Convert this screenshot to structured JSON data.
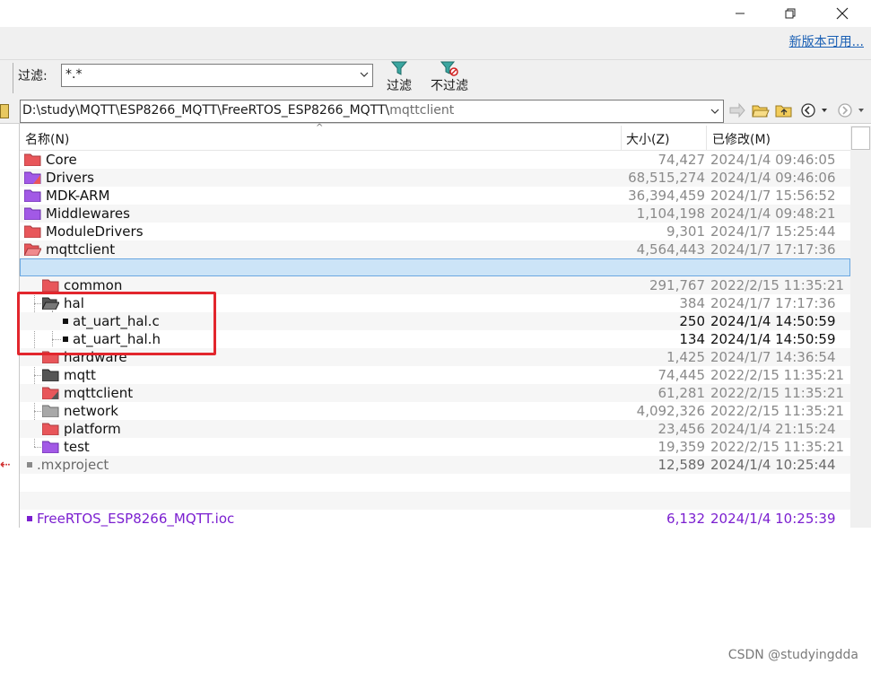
{
  "window": {
    "minimize_icon": "minimize-icon",
    "maximize_icon": "restore-icon",
    "close_icon": "close-icon"
  },
  "toolbar": {
    "new_version_link": "新版本可用...",
    "filter_label": "过滤:",
    "filter_value": "*.*",
    "filter_button_label": "过滤",
    "no_filter_button_label": "不过滤"
  },
  "pathbar": {
    "path_prefix": "D:\\study\\MQTT\\ESP8266_MQTT\\FreeRTOS_ESP8266_MQTT\\",
    "path_current": "mqttclient"
  },
  "columns": {
    "name": "名称(N)",
    "size": "大小(Z)",
    "modified": "已修改(M)"
  },
  "rows": [
    {
      "name": "Core",
      "size": "74,427",
      "date": "2024/1/4 09:46:05"
    },
    {
      "name": "Drivers",
      "size": "68,515,274",
      "date": "2024/1/4 09:46:06"
    },
    {
      "name": "MDK-ARM",
      "size": "36,394,459",
      "date": "2024/1/7 15:56:52"
    },
    {
      "name": "Middlewares",
      "size": "1,104,198",
      "date": "2024/1/4 09:48:21"
    },
    {
      "name": "ModuleDrivers",
      "size": "9,301",
      "date": "2024/1/7 15:25:44"
    },
    {
      "name": "mqttclient",
      "size": "4,564,443",
      "date": "2024/1/7 17:17:36"
    },
    {
      "name": "",
      "size": "",
      "date": ""
    },
    {
      "name": "common",
      "size": "291,767",
      "date": "2022/2/15 11:35:21"
    },
    {
      "name": "hal",
      "size": "384",
      "date": "2024/1/7 17:17:36"
    },
    {
      "name": "at_uart_hal.c",
      "size": "250",
      "date": "2024/1/4 14:50:59"
    },
    {
      "name": "at_uart_hal.h",
      "size": "134",
      "date": "2024/1/4 14:50:59"
    },
    {
      "name": "hardware",
      "size": "1,425",
      "date": "2024/1/7 14:36:54"
    },
    {
      "name": "mqtt",
      "size": "74,445",
      "date": "2022/2/15 11:35:21"
    },
    {
      "name": "mqttclient",
      "size": "61,281",
      "date": "2022/2/15 11:35:21"
    },
    {
      "name": "network",
      "size": "4,092,326",
      "date": "2022/2/15 11:35:21"
    },
    {
      "name": "platform",
      "size": "23,456",
      "date": "2024/1/4 21:15:24"
    },
    {
      "name": "test",
      "size": "19,359",
      "date": "2022/2/15 11:35:21"
    },
    {
      "name": ".mxproject",
      "size": "12,589",
      "date": "2024/1/4 10:25:44"
    },
    {
      "name": "FreeRTOS_ESP8266_MQTT.ioc",
      "size": "6,132",
      "date": "2024/1/4 10:25:39"
    }
  ],
  "colors": {
    "folder_red": "#e8565a",
    "folder_purple": "#a259e6",
    "folder_grey": "#8a8a8a",
    "selection": "#cce4f7",
    "annotation_red": "#e2262d",
    "purple_text": "#7b1fd0"
  },
  "watermark": "CSDN @studyingdda"
}
